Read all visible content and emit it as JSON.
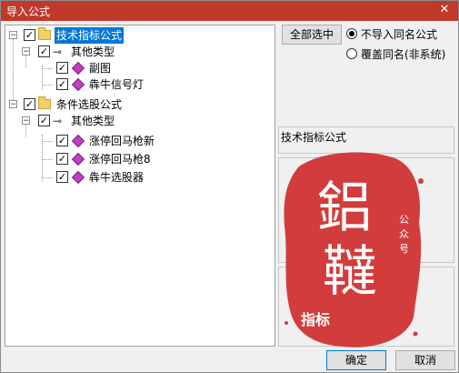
{
  "window": {
    "title": "导入公式",
    "close_glyph": "✕"
  },
  "tree": {
    "nodes": [
      {
        "label": "技术指标公式",
        "selected": true
      },
      {
        "label": "其他类型"
      },
      {
        "label": "副图"
      },
      {
        "label": "犇牛信号灯"
      },
      {
        "label": "条件选股公式"
      },
      {
        "label": "其他类型"
      },
      {
        "label": "涨停回马枪新"
      },
      {
        "label": "涨停回马枪8"
      },
      {
        "label": "犇牛选股器"
      }
    ]
  },
  "options": {
    "select_all_label": "全部选中",
    "radio1_label": "不导入同名公式",
    "radio2_label": "覆盖同名(非系统)"
  },
  "info": {
    "section_label": "技术指标公式"
  },
  "watermark": {
    "main_chars": "鋁 韃",
    "sub_text": "公众号",
    "bottom_text": "指标"
  },
  "buttons": {
    "ok_label": "确定",
    "cancel_label": "取消"
  },
  "colors": {
    "title_bar": "#c0392b",
    "seal": "#d23c3c",
    "selection": "#0078d7"
  }
}
